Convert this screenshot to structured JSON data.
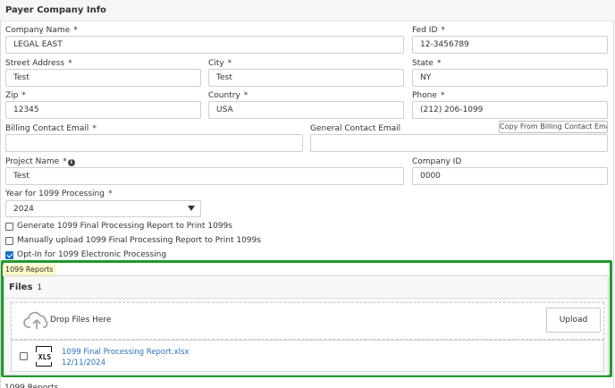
{
  "header": {
    "title": "Payer Company Info"
  },
  "form": {
    "company_name": {
      "label": "Company Name",
      "required": "*",
      "value": "LEGAL EAST"
    },
    "fed_id": {
      "label": "Fed ID",
      "required": "*",
      "value": "12-3456789"
    },
    "street_address": {
      "label": "Street Address",
      "required": "*",
      "value": "Test"
    },
    "city": {
      "label": "City",
      "required": "*",
      "value": "Test"
    },
    "state": {
      "label": "State",
      "required": "*",
      "value": "NY"
    },
    "zip": {
      "label": "Zip",
      "required": "*",
      "value": "12345"
    },
    "country": {
      "label": "Country",
      "required": "*",
      "value": "USA"
    },
    "phone": {
      "label": "Phone",
      "required": "*",
      "value": "(212) 206-1099"
    },
    "billing_contact_email": {
      "label": "Billing Contact Email",
      "required": "*",
      "value": ""
    },
    "general_contact_email": {
      "label": "General Contact Email",
      "value": ""
    },
    "copy_button": "Copy From Billing Contact Email",
    "project_name": {
      "label": "Project Name",
      "required": "*",
      "info_icon": "info-icon",
      "value": "Test"
    },
    "company_id": {
      "label": "Company ID",
      "value": "0000"
    },
    "year": {
      "label": "Year for 1099 Processing",
      "required": "*",
      "value": "2024"
    },
    "options": [
      {
        "label": "Generate 1099 Final Processing Report to Print 1099s",
        "checked": false
      },
      {
        "label": "Manually upload 1099 Final Processing Report to Print 1099s",
        "checked": false
      },
      {
        "label": "Opt-In for 1099 Electronic Processing",
        "checked": true
      }
    ]
  },
  "reports": {
    "tag": "1099 Reports",
    "files_label": "Files",
    "files_count": "1",
    "dropzone": {
      "icon": "cloud-upload-icon",
      "text": "Drop Files Here",
      "upload_label": "Upload"
    },
    "files": [
      {
        "icon": "xls-file-icon",
        "icon_text": "XLS",
        "name": "1099 Final Processing Report.xlsx",
        "date": "12/11/2024"
      }
    ]
  },
  "colors": {
    "highlight_border": "#1f9a2d",
    "link": "#2a6fbf",
    "tag_bg": "#fbf8c5",
    "checkbox": "#1a73c9"
  }
}
